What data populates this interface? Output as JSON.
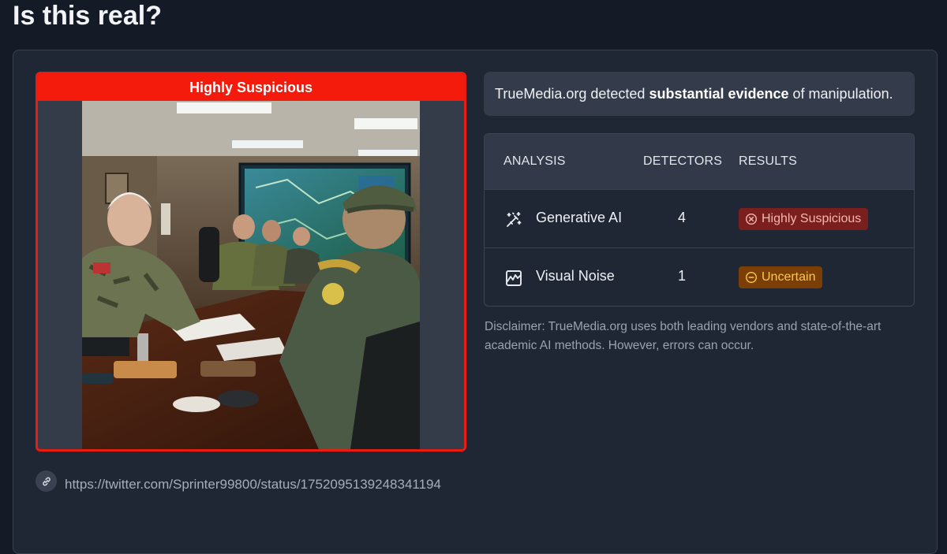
{
  "page": {
    "title": "Is this real?"
  },
  "media": {
    "verdict_banner": "Highly Suspicious",
    "source_url": "https://twitter.com/Sprinter99800/status/1752095139248341194"
  },
  "summary": {
    "prefix": "TrueMedia.org detected ",
    "emphasis": "substantial evidence",
    "suffix": " of manipulation."
  },
  "analysis": {
    "headers": {
      "analysis": "ANALYSIS",
      "detectors": "DETECTORS",
      "results": "RESULTS"
    },
    "rows": [
      {
        "icon": "magic-wand-icon",
        "label": "Generative AI",
        "detectors": "4",
        "result": "Highly Suspicious",
        "result_icon": "x-circle-icon",
        "result_color": "#7a1e1e"
      },
      {
        "icon": "image-waveform-icon",
        "label": "Visual Noise",
        "detectors": "1",
        "result": "Uncertain",
        "result_icon": "minus-circle-icon",
        "result_color": "#7a3e06"
      }
    ]
  },
  "disclaimer": "Disclaimer: TrueMedia.org uses both leading vendors and state-of-the-art academic AI methods. However, errors can occur.",
  "colors": {
    "background": "#141b27",
    "card": "#1f2735",
    "alert_red": "#f41a0c",
    "uncertain_amber": "#fcc84a"
  }
}
